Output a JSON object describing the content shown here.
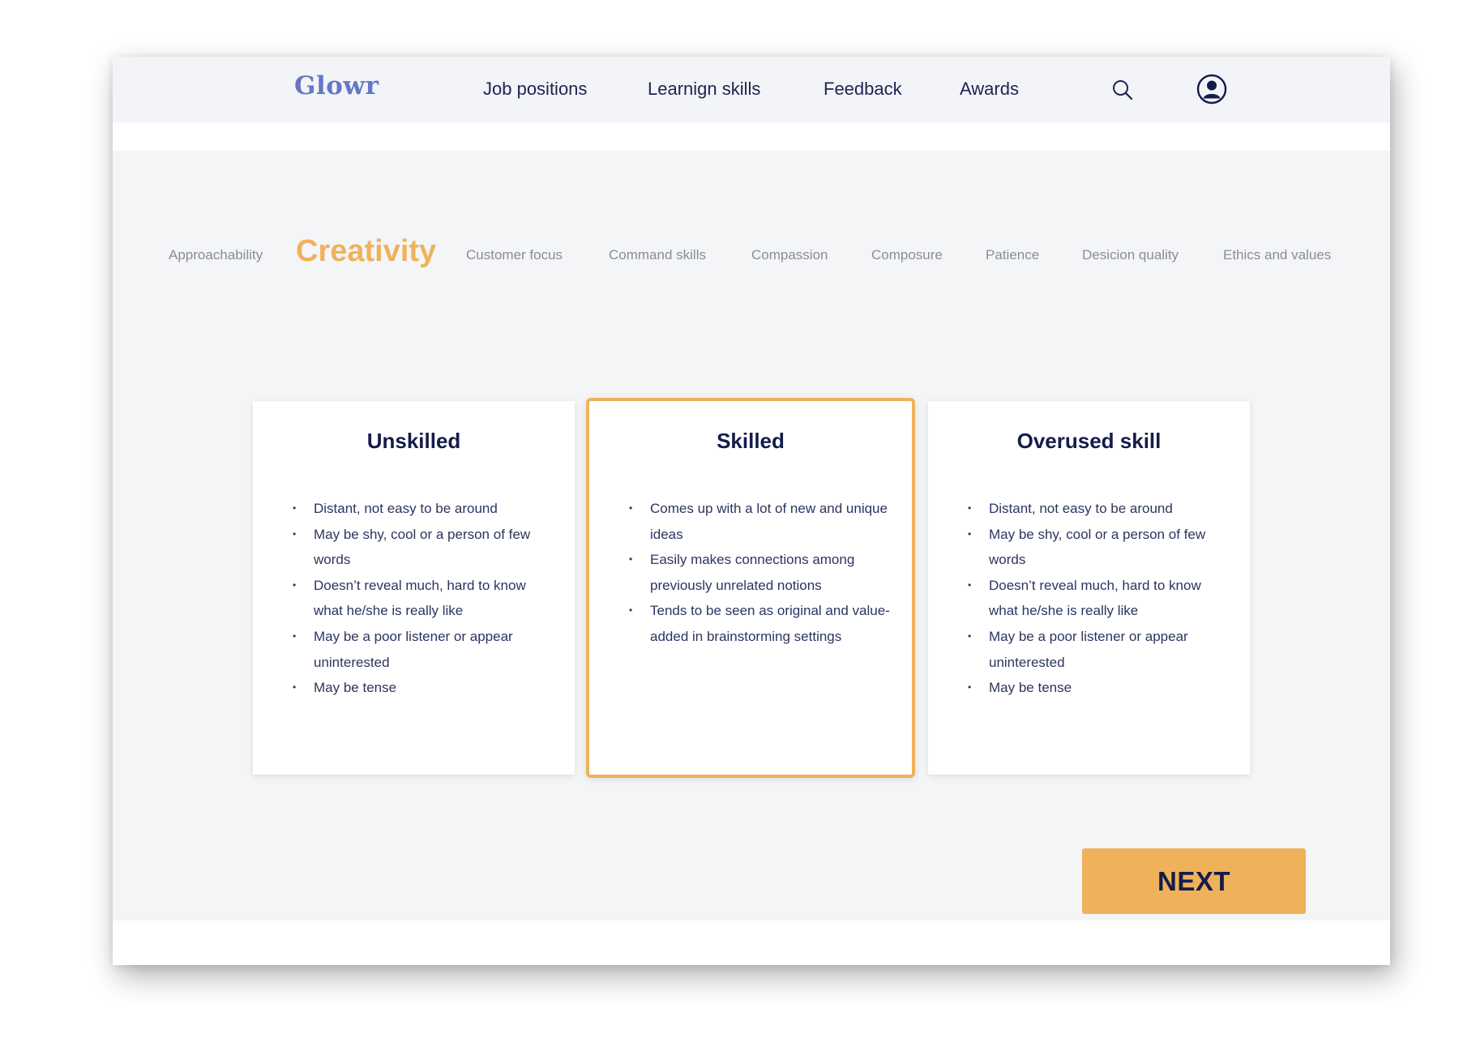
{
  "app": {
    "logo": "Glowr"
  },
  "nav": {
    "items": [
      {
        "label": "Job positions"
      },
      {
        "label": "Learnign skills"
      },
      {
        "label": "Feedback"
      },
      {
        "label": "Awards"
      }
    ],
    "icons": [
      "search-icon",
      "user-profile-icon"
    ]
  },
  "skills": {
    "tabs": [
      {
        "label": "Approachability"
      },
      {
        "label": "Creativity",
        "active": true
      },
      {
        "label": "Customer focus"
      },
      {
        "label": "Command skills"
      },
      {
        "label": "Compassion"
      },
      {
        "label": "Composure"
      },
      {
        "label": "Patience"
      },
      {
        "label": "Desicion quality"
      },
      {
        "label": "Ethics and values"
      }
    ]
  },
  "cards": [
    {
      "title": "Unskilled",
      "items": [
        "Distant, not easy to be around",
        "May be shy, cool or a person of few words",
        "Doesn’t reveal much, hard to know what he/she is really like",
        "May be a poor listener or appear uninterested",
        "May be tense"
      ]
    },
    {
      "title": "Skilled",
      "selected": true,
      "items": [
        "Comes up with a lot of new and unique ideas",
        "Easily makes connections among previously unrelated notions",
        "Tends to be seen as original and value-added in brainstorming settings"
      ]
    },
    {
      "title": "Overused skill",
      "items": [
        "Distant, not easy to be around",
        "May be shy, cool or a person of few words",
        "Doesn’t reveal much, hard to know what he/she is really like",
        "May be a poor listener or appear uninterested",
        "May be tense"
      ]
    }
  ],
  "actions": {
    "next_label": "NEXT"
  },
  "colors": {
    "accent": "#efb25b",
    "logo": "#6677c8",
    "text_dark": "#141c4a"
  }
}
